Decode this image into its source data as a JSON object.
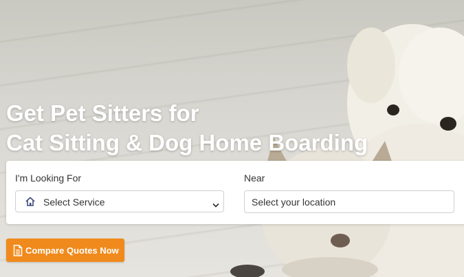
{
  "hero": {
    "headline_line1": "Get Pet Sitters for",
    "headline_line2": "Cat Sitting & Dog Home Boarding"
  },
  "search": {
    "service_label": "I'm Looking For",
    "service_icon": "home-icon",
    "service_selected": "Select Service",
    "location_label": "Near",
    "location_placeholder": "Select your location"
  },
  "cta": {
    "icon": "document-icon",
    "label": "Compare Quotes Now",
    "color": "#f08a1c"
  }
}
